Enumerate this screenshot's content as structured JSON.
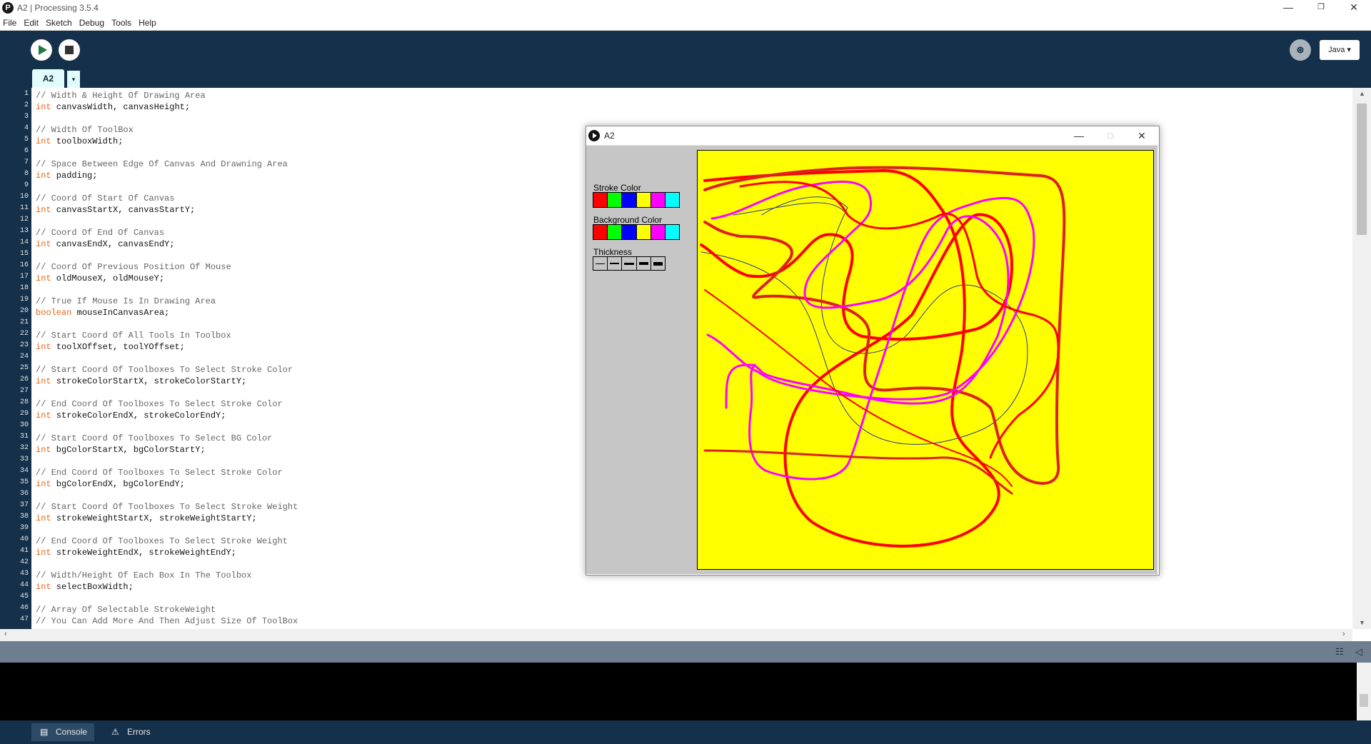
{
  "window": {
    "title": "A2 | Processing 3.5.4",
    "app_icon": "processing-icon",
    "controls": [
      "minimize-icon",
      "restore-icon",
      "close-icon"
    ]
  },
  "menu": [
    "File",
    "Edit",
    "Sketch",
    "Debug",
    "Tools",
    "Help"
  ],
  "toolbar": {
    "run_icon": "play-icon",
    "stop_icon": "stop-icon",
    "debug_icon": "debugger-icon",
    "mode_label": "Java ▾"
  },
  "tabs": {
    "active": "A2",
    "menu_glyph": "▾"
  },
  "editor": {
    "line_numbers": [
      "1",
      "2",
      "3",
      "4",
      "5",
      "6",
      "7",
      "8",
      "9",
      "10",
      "11",
      "12",
      "13",
      "14",
      "15",
      "16",
      "17",
      "18",
      "19",
      "20",
      "21",
      "22",
      "23",
      "24",
      "25",
      "26",
      "27",
      "28",
      "29",
      "30",
      "31",
      "32",
      "33",
      "34",
      "35",
      "36",
      "37",
      "38",
      "39",
      "40",
      "41",
      "42",
      "43",
      "44",
      "45",
      "46",
      "47"
    ],
    "lines": [
      "// Width & Height Of Drawing Area",
      "int canvasWidth, canvasHeight;",
      "",
      "// Width Of ToolBox",
      "int toolboxWidth;",
      "",
      "// Space Between Edge Of Canvas And Drawning Area",
      "int padding;",
      "",
      "// Coord Of Start Of Canvas",
      "int canvasStartX, canvasStartY;",
      "",
      "// Coord Of End Of Canvas",
      "int canvasEndX, canvasEndY;",
      "",
      "// Coord Of Previous Position Of Mouse",
      "int oldMouseX, oldMouseY;",
      "",
      "// True If Mouse Is In Drawing Area",
      "boolean mouseInCanvasArea;",
      "",
      "// Start Coord Of All Tools In Toolbox",
      "int toolXOffset, toolYOffset;",
      "",
      "// Start Coord Of Toolboxes To Select Stroke Color",
      "int strokeColorStartX, strokeColorStartY;",
      "",
      "// End Coord Of Toolboxes To Select Stroke Color",
      "int strokeColorEndX, strokeColorEndY;",
      "",
      "// Start Coord Of Toolboxes To Select BG Color",
      "int bgColorStartX, bgColorStartY;",
      "",
      "// End Coord Of Toolboxes To Select Stroke Color",
      "int bgColorEndX, bgColorEndY;",
      "",
      "// Start Coord Of Toolboxes To Select Stroke Weight",
      "int strokeWeightStartX, strokeWeightStartY;",
      "",
      "// End Coord Of Toolboxes To Select Stroke Weight",
      "int strokeWeightEndX, strokeWeightEndY;",
      "",
      "// Width/Height Of Each Box In The Toolbox",
      "int selectBoxWidth;",
      "",
      "// Array Of Selectable StrokeWeight",
      "// You Can Add More And Then Adjust Size Of ToolBox"
    ]
  },
  "console": {
    "tabs": [
      {
        "label": "Console",
        "icon": "console-icon"
      },
      {
        "label": "Errors",
        "icon": "warning-icon"
      }
    ]
  },
  "sketch": {
    "title": "A2",
    "toolbox": {
      "stroke_label": "Stroke Color",
      "background_label": "Background Color",
      "thickness_label": "Thickness",
      "colors": [
        "#ff0000",
        "#00ff00",
        "#0000ff",
        "#ffff00",
        "#ff00ff",
        "#00ffff"
      ],
      "thickness_levels": 5
    },
    "canvas": {
      "background": "#ffff00",
      "stroke_colors": [
        "#ff0000",
        "#0000cc",
        "#ff00ff",
        "#2a3a8a",
        "#dd2020"
      ]
    }
  }
}
